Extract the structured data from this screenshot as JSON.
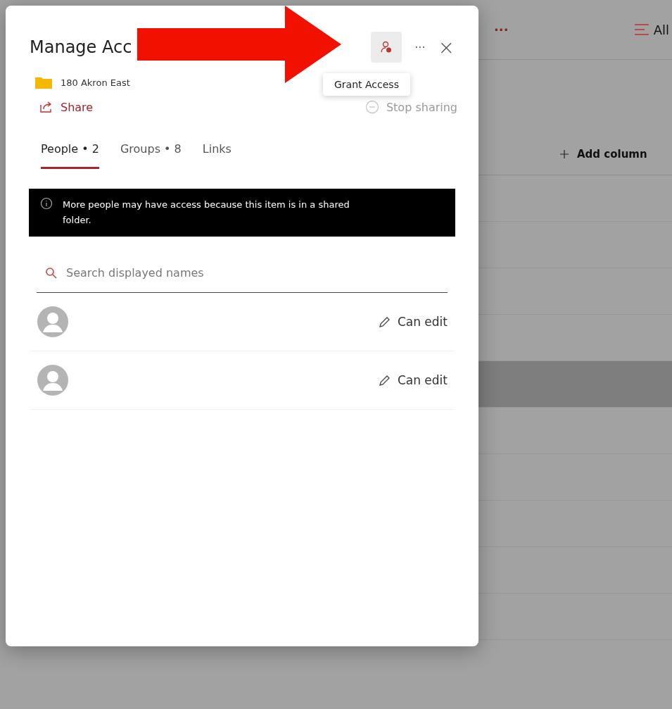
{
  "background": {
    "toolbar": {
      "more": "···",
      "view": "All"
    },
    "header": {
      "add_column": "Add column"
    },
    "rows": [
      {
        "selected": false
      },
      {
        "selected": false
      },
      {
        "selected": false
      },
      {
        "selected": false
      },
      {
        "selected": true
      },
      {
        "selected": false
      },
      {
        "selected": false
      },
      {
        "selected": false
      },
      {
        "selected": false
      },
      {
        "selected": false
      }
    ]
  },
  "panel": {
    "title": "Manage Acc",
    "more": "···",
    "close": "×",
    "tooltip": "Grant Access",
    "item": "180 Akron East",
    "share": "Share",
    "stop_sharing": "Stop sharing",
    "tabs": [
      {
        "label": "People • 2",
        "selected": true
      },
      {
        "label": "Groups • 8",
        "selected": false
      },
      {
        "label": "Links",
        "selected": false
      }
    ],
    "banner": {
      "text": "More people may have access because this item is in a shared folder."
    },
    "search": {
      "placeholder": "Search displayed names"
    },
    "people": [
      {
        "permission": "Can edit"
      },
      {
        "permission": "Can edit"
      }
    ]
  }
}
